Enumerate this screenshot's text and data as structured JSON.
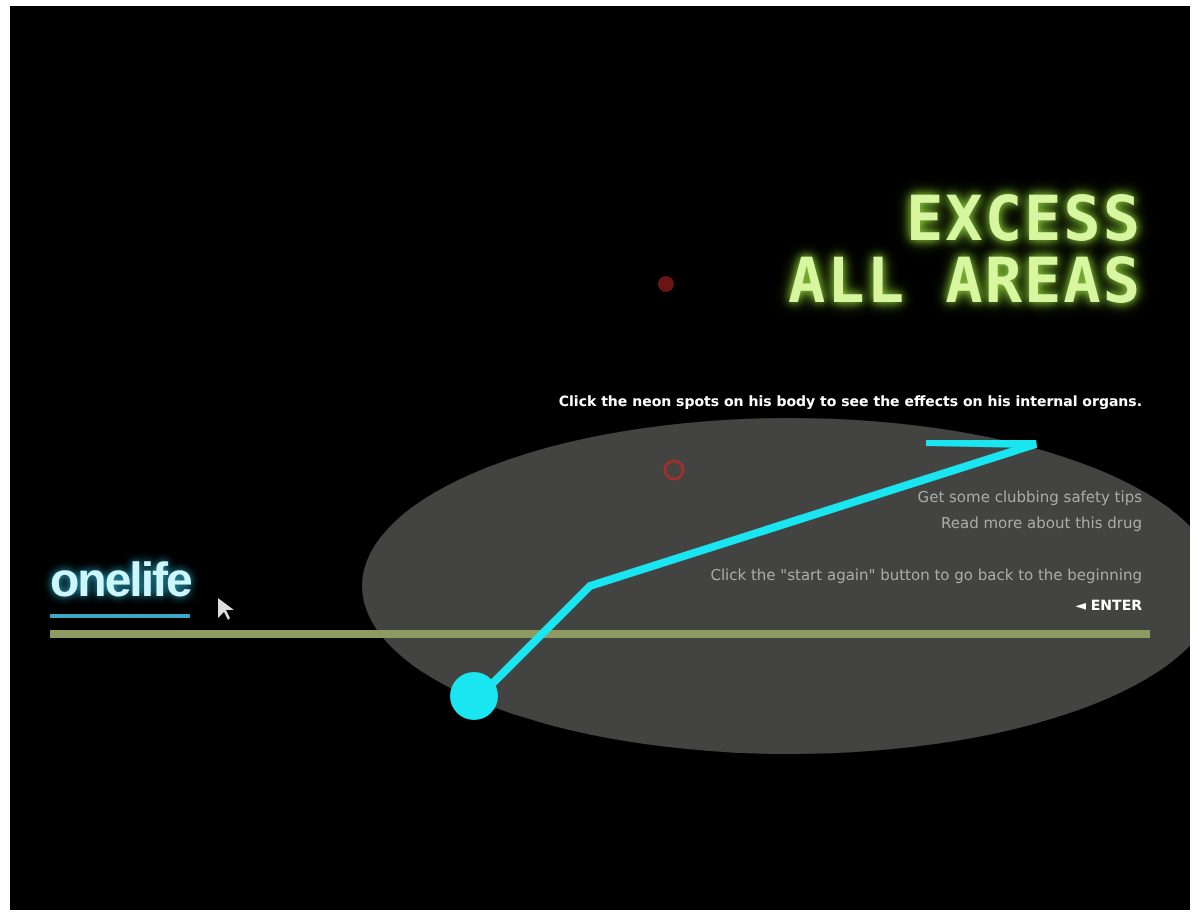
{
  "title": {
    "line_1": "EXCESS",
    "line_2": "ALL AREAS"
  },
  "instruction": "Click the neon spots on his body to see the effects on his internal organs.",
  "tips": [
    "Get some clubbing safety tips",
    "Read more about this drug"
  ],
  "restart_hint": "Click the \"start again\" button to go back to the beginning",
  "enter": {
    "marker": "◄",
    "label": "ENTER"
  },
  "logo": "onelife"
}
